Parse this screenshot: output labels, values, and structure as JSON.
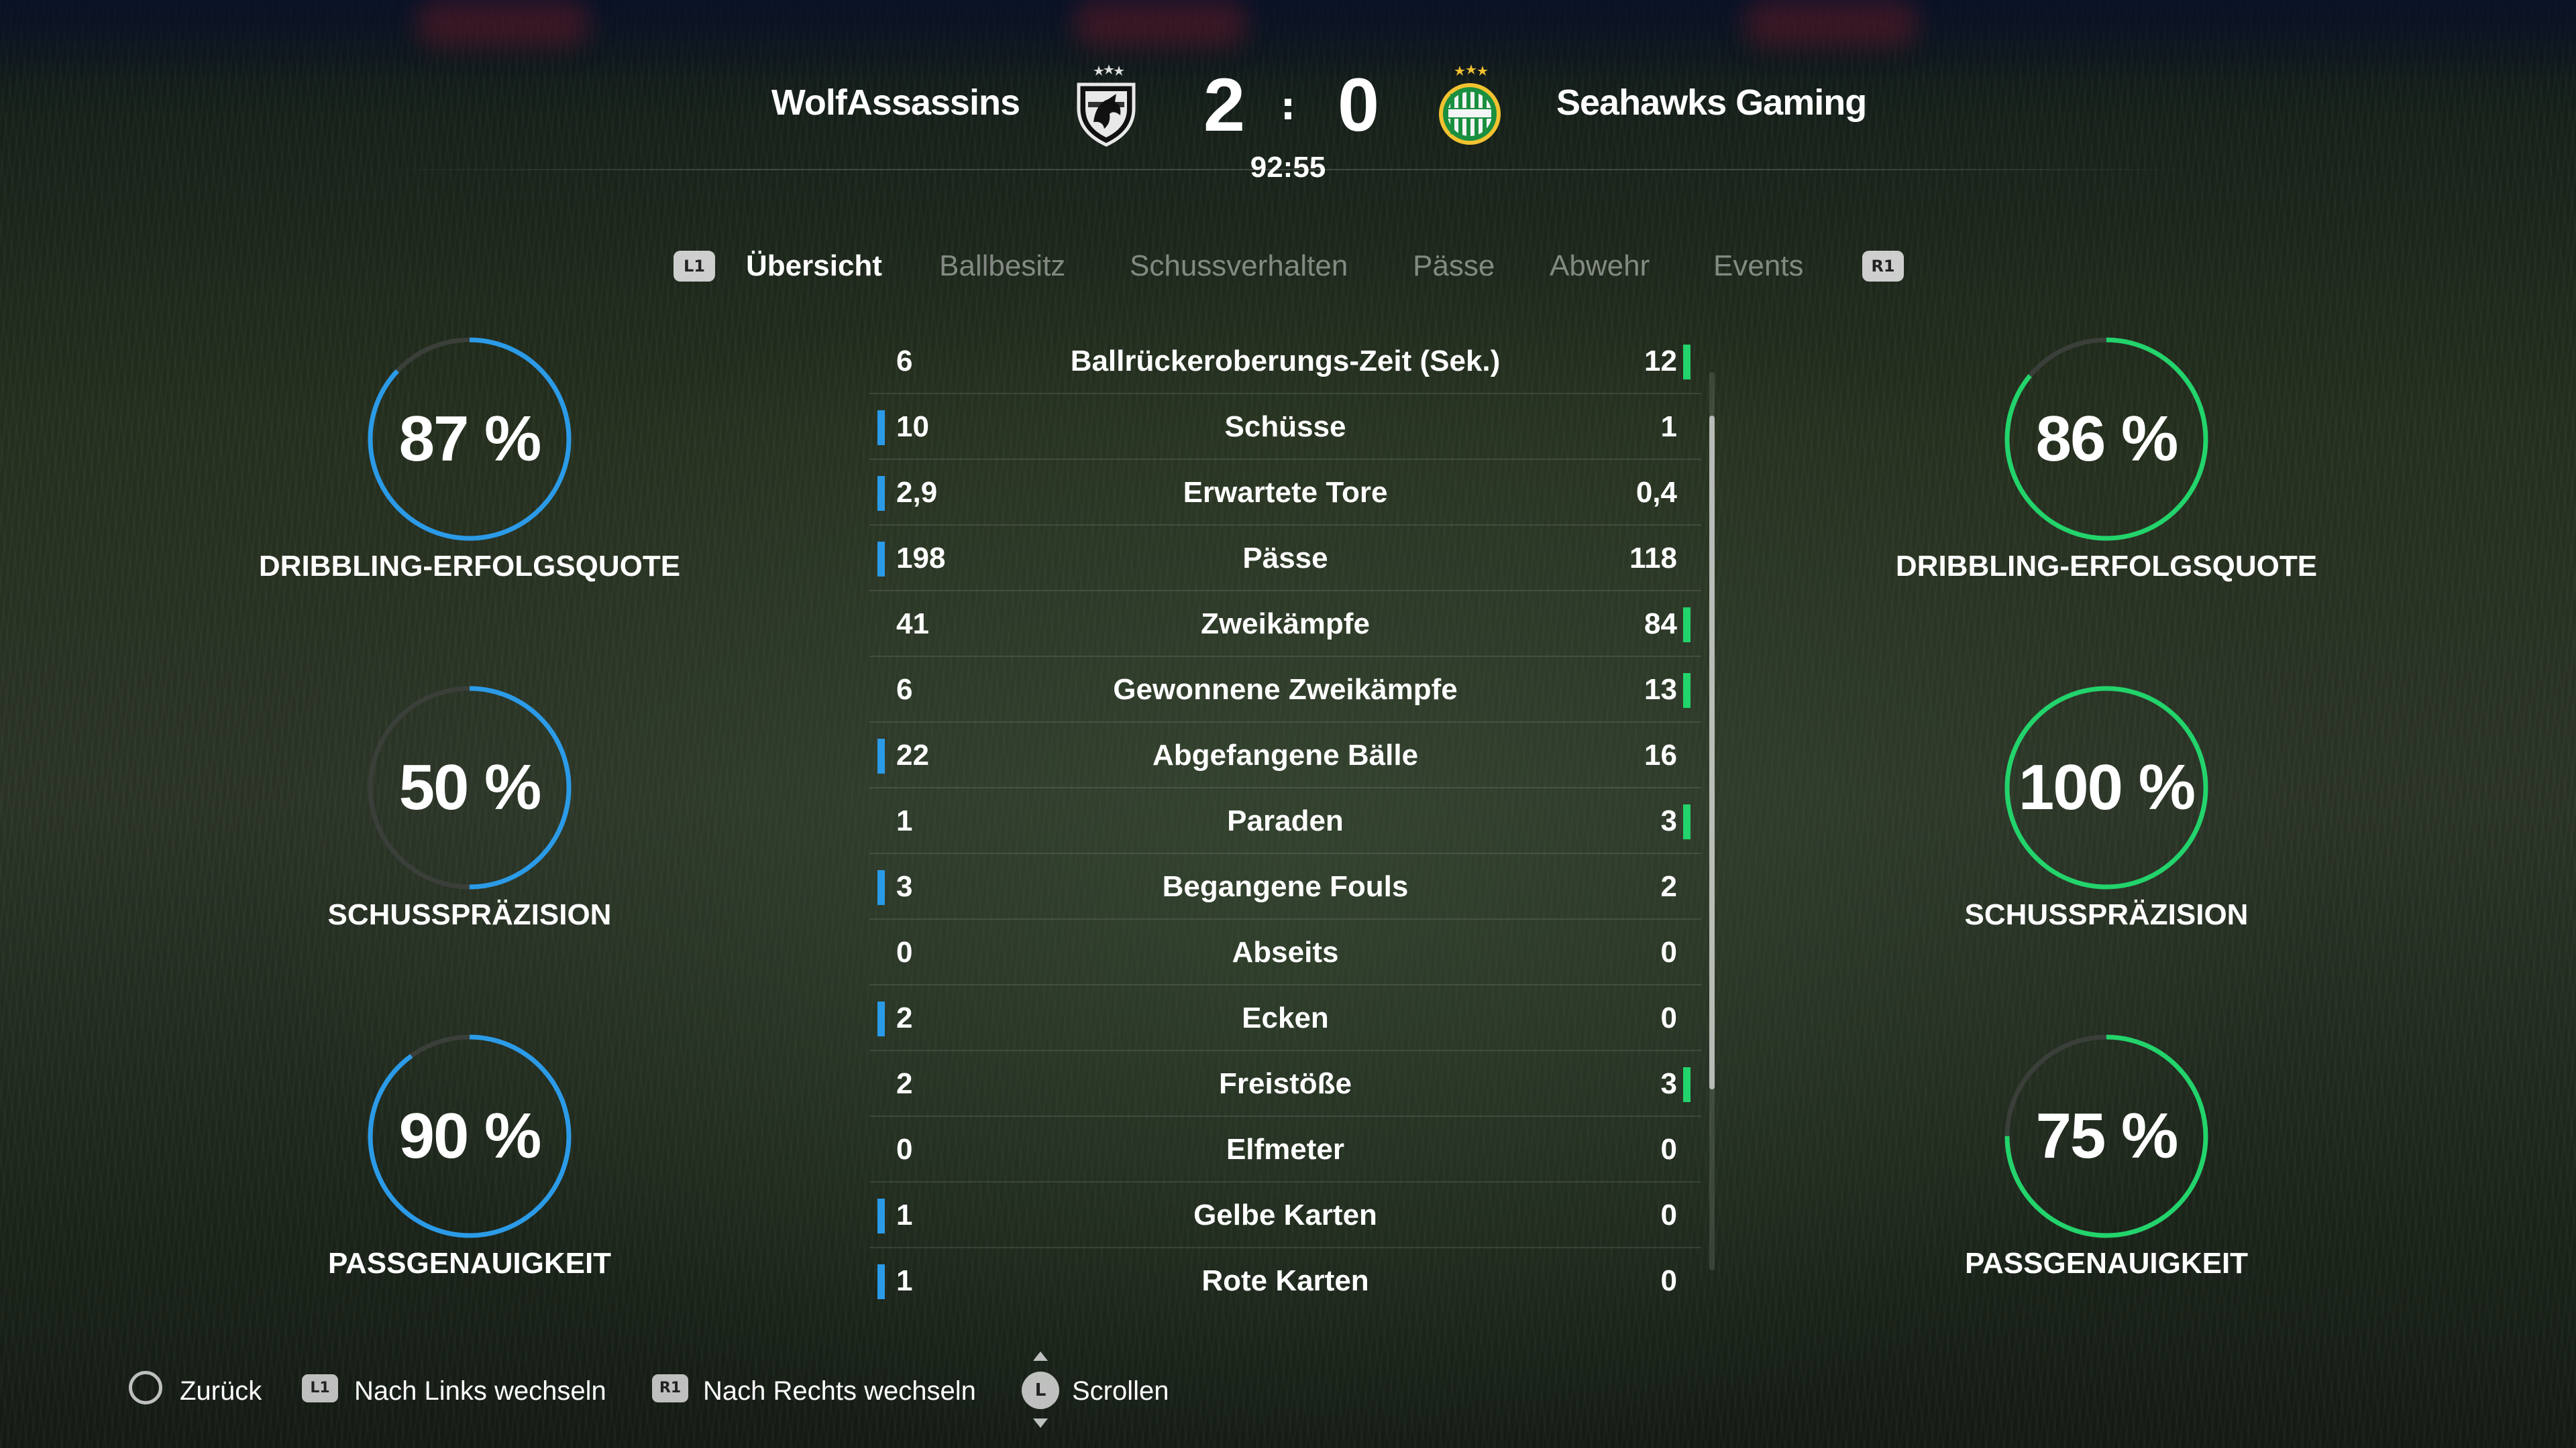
{
  "match": {
    "home_team": "WolfAssassins",
    "away_team": "Seahawks Gaming",
    "home_score": "2",
    "separator": ":",
    "away_score": "0",
    "clock": "92:55"
  },
  "tabs": {
    "left_shoulder": "L1",
    "right_shoulder": "R1",
    "items": [
      {
        "label": "Übersicht",
        "active": true
      },
      {
        "label": "Ballbesitz",
        "active": false
      },
      {
        "label": "Schussverhalten",
        "active": false
      },
      {
        "label": "Pässe",
        "active": false
      },
      {
        "label": "Abwehr",
        "active": false
      },
      {
        "label": "Events",
        "active": false
      }
    ]
  },
  "colors": {
    "home_accent": "#2b9be8",
    "away_accent": "#22d46b",
    "ring_track": "#3a3f3a"
  },
  "home_gauges": [
    {
      "percent": 87,
      "text": "87 %",
      "label": "DRIBBLING-ERFOLGSQUOTE"
    },
    {
      "percent": 50,
      "text": "50 %",
      "label": "SCHUSSPRÄZISION"
    },
    {
      "percent": 90,
      "text": "90 %",
      "label": "PASSGENAUIGKEIT"
    }
  ],
  "away_gauges": [
    {
      "percent": 86,
      "text": "86 %",
      "label": "DRIBBLING-ERFOLGSQUOTE"
    },
    {
      "percent": 100,
      "text": "100 %",
      "label": "SCHUSSPRÄZISION"
    },
    {
      "percent": 75,
      "text": "75 %",
      "label": "PASSGENAUIGKEIT"
    }
  ],
  "stats": [
    {
      "name": "Ballrückeroberungs-Zeit (Sek.)",
      "home": "6",
      "away": "12",
      "leader": "away"
    },
    {
      "name": "Schüsse",
      "home": "10",
      "away": "1",
      "leader": "home"
    },
    {
      "name": "Erwartete Tore",
      "home": "2,9",
      "away": "0,4",
      "leader": "home"
    },
    {
      "name": "Pässe",
      "home": "198",
      "away": "118",
      "leader": "home"
    },
    {
      "name": "Zweikämpfe",
      "home": "41",
      "away": "84",
      "leader": "away"
    },
    {
      "name": "Gewonnene Zweikämpfe",
      "home": "6",
      "away": "13",
      "leader": "away"
    },
    {
      "name": "Abgefangene Bälle",
      "home": "22",
      "away": "16",
      "leader": "home"
    },
    {
      "name": "Paraden",
      "home": "1",
      "away": "3",
      "leader": "away"
    },
    {
      "name": "Begangene Fouls",
      "home": "3",
      "away": "2",
      "leader": "home"
    },
    {
      "name": "Abseits",
      "home": "0",
      "away": "0",
      "leader": "none"
    },
    {
      "name": "Ecken",
      "home": "2",
      "away": "0",
      "leader": "home"
    },
    {
      "name": "Freistöße",
      "home": "2",
      "away": "3",
      "leader": "away"
    },
    {
      "name": "Elfmeter",
      "home": "0",
      "away": "0",
      "leader": "none"
    },
    {
      "name": "Gelbe Karten",
      "home": "1",
      "away": "0",
      "leader": "home"
    },
    {
      "name": "Rote Karten",
      "home": "1",
      "away": "0",
      "leader": "home"
    }
  ],
  "footer": {
    "back": {
      "label": "Zurück",
      "icon": "circle-button-icon"
    },
    "left": {
      "label": "Nach Links wechseln",
      "button": "L1"
    },
    "right": {
      "label": "Nach Rechts wechseln",
      "button": "R1"
    },
    "scroll": {
      "label": "Scrollen",
      "button": "L"
    }
  }
}
